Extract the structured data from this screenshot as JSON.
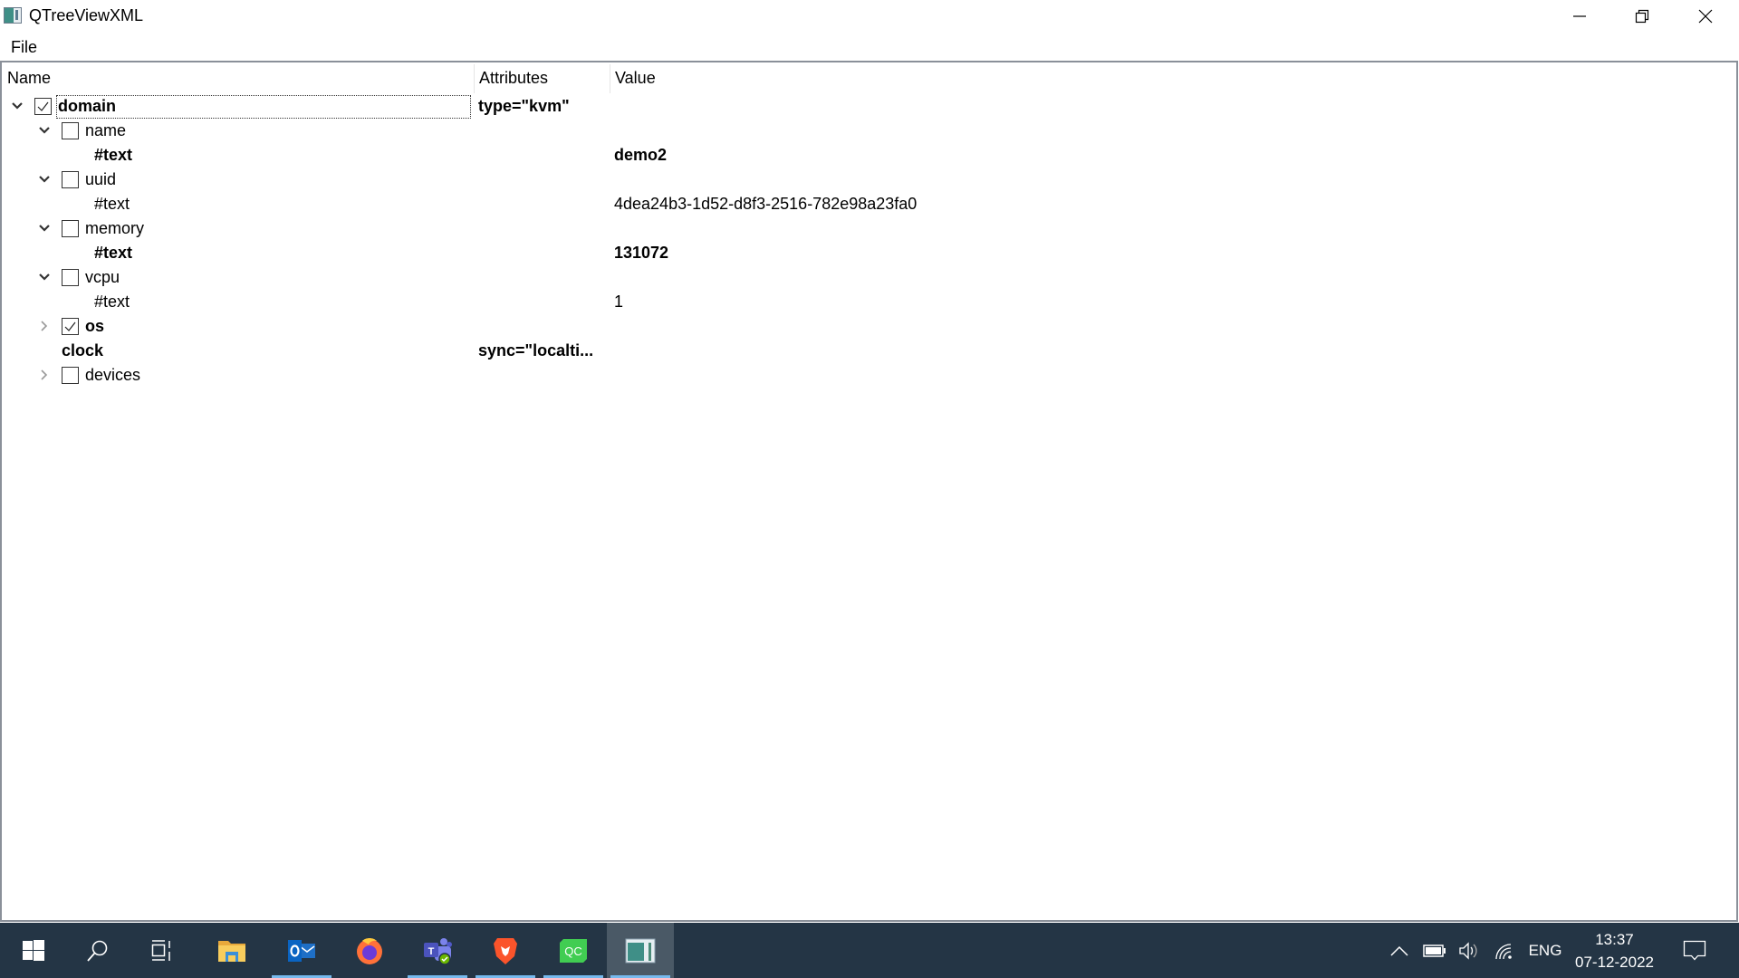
{
  "window": {
    "title": "QTreeViewXML",
    "controls": {
      "minimize": "minimize",
      "restore": "restore",
      "close": "close"
    }
  },
  "menubar": {
    "items": [
      {
        "label": "File"
      }
    ]
  },
  "tree": {
    "columns": [
      "Name",
      "Attributes",
      "Value"
    ],
    "rows": [
      {
        "name": "domain",
        "attributes": "type=\"kvm\"",
        "value": "",
        "level": 0,
        "expander": "expanded",
        "checkbox": true,
        "checked": true,
        "bold": true,
        "focused": true
      },
      {
        "name": "name",
        "attributes": "",
        "value": "",
        "level": 1,
        "expander": "expanded",
        "checkbox": true,
        "checked": false,
        "bold": false
      },
      {
        "name": "#text",
        "attributes": "",
        "value": "demo2",
        "level": 2,
        "expander": "none",
        "checkbox": false,
        "checked": false,
        "bold": true
      },
      {
        "name": "uuid",
        "attributes": "",
        "value": "",
        "level": 1,
        "expander": "expanded",
        "checkbox": true,
        "checked": false,
        "bold": false
      },
      {
        "name": "#text",
        "attributes": "",
        "value": "4dea24b3-1d52-d8f3-2516-782e98a23fa0",
        "level": 2,
        "expander": "none",
        "checkbox": false,
        "checked": false,
        "bold": false
      },
      {
        "name": "memory",
        "attributes": "",
        "value": "",
        "level": 1,
        "expander": "expanded",
        "checkbox": true,
        "checked": false,
        "bold": false
      },
      {
        "name": "#text",
        "attributes": "",
        "value": "131072",
        "level": 2,
        "expander": "none",
        "checkbox": false,
        "checked": false,
        "bold": true
      },
      {
        "name": "vcpu",
        "attributes": "",
        "value": "",
        "level": 1,
        "expander": "expanded",
        "checkbox": true,
        "checked": false,
        "bold": false
      },
      {
        "name": "#text",
        "attributes": "",
        "value": "1",
        "level": 2,
        "expander": "none",
        "checkbox": false,
        "checked": false,
        "bold": false
      },
      {
        "name": "os",
        "attributes": "",
        "value": "",
        "level": 1,
        "expander": "collapsed",
        "checkbox": true,
        "checked": true,
        "bold": true
      },
      {
        "name": "clock",
        "attributes": "sync=\"localti...",
        "value": "",
        "level": 1,
        "expander": "none",
        "checkbox": false,
        "checked": false,
        "bold": true,
        "no_indent_box": true
      },
      {
        "name": "devices",
        "attributes": "",
        "value": "",
        "level": 1,
        "expander": "collapsed",
        "checkbox": true,
        "checked": false,
        "bold": false
      }
    ]
  },
  "taskbar": {
    "items": [
      {
        "name": "start",
        "icon": "windows-logo-icon"
      },
      {
        "name": "search",
        "icon": "search-icon"
      },
      {
        "name": "task-view",
        "icon": "task-view-icon"
      },
      {
        "name": "file-explorer",
        "icon": "folder-icon"
      },
      {
        "name": "outlook",
        "icon": "outlook-icon",
        "running": true
      },
      {
        "name": "firefox",
        "icon": "firefox-icon"
      },
      {
        "name": "teams",
        "icon": "teams-icon",
        "running": true
      },
      {
        "name": "brave",
        "icon": "brave-icon",
        "running": true
      },
      {
        "name": "qt-creator",
        "icon": "qt-creator-icon",
        "running": true,
        "label": "QC"
      },
      {
        "name": "qtreeviewxml",
        "icon": "app-window-icon",
        "running": true,
        "active": true
      }
    ],
    "tray": {
      "language": "ENG",
      "time": "13:37",
      "date": "07-12-2022"
    }
  },
  "colors": {
    "taskbar_bg": "#243545",
    "taskbar_active": "#4a5966",
    "running_indicator": "#76b9ed",
    "frame_border": "#8a9099"
  }
}
